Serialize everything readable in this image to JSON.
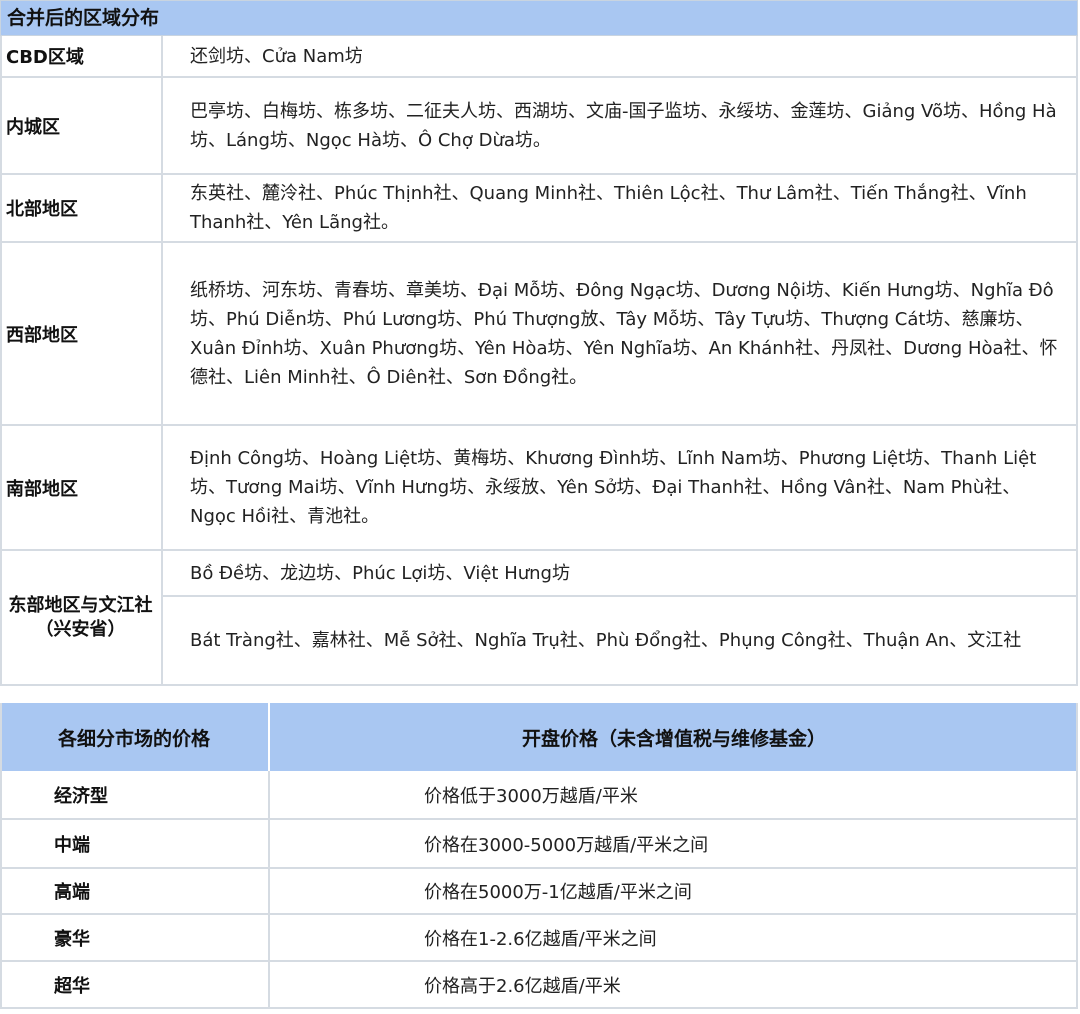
{
  "region_table": {
    "title": "合并后的区域分布",
    "rows": [
      {
        "label": "CBD区域",
        "text": "还剑坊、Cửa Nam坊"
      },
      {
        "label": "内城区",
        "text": "巴亭坊、白梅坊、栋多坊、二征夫人坊、西湖坊、文庙-国子监坊、永绥坊、金莲坊、Giảng Võ坊、Hồng Hà坊、Láng坊、Ngọc Hà坊、Ô Chợ Dừa坊。"
      },
      {
        "label": "北部地区",
        "text": "东英社、麓泠社、Phúc Thịnh社、Quang Minh社、Thiên Lộc社、Thư Lâm社、Tiến Thắng社、Vĩnh Thanh社、Yên Lãng社。"
      },
      {
        "label": "西部地区",
        "text": "纸桥坊、河东坊、青春坊、章美坊、Đại Mỗ坊、Đông Ngạc坊、Dương Nội坊、Kiến Hưng坊、Nghĩa Đô坊、Phú Diễn坊、Phú Lương坊、Phú Thượng放、Tây Mỗ坊、Tây Tựu坊、Thượng Cát坊、慈廉坊、Xuân Đỉnh坊、Xuân Phương坊、Yên Hòa坊、Yên Nghĩa坊、An Khánh社、丹凤社、Dương Hòa社、怀德社、Liên Minh社、Ô Diên社、Sơn Đồng社。"
      },
      {
        "label": "南部地区",
        "text": "Định Công坊、Hoàng Liệt坊、黄梅坊、Khương Đình坊、Lĩnh Nam坊、Phương Liệt坊、Thanh Liệt坊、Tương Mai坊、Vĩnh Hưng坊、永绥放、Yên Sở坊、Đại Thanh社、Hồng Vân社、Nam Phù社、Ngọc Hồi社、青池社。"
      },
      {
        "label": "东部地区与文江社（兴安省）",
        "text_a": "Bồ Đề坊、龙边坊、Phúc Lợi坊、Việt Hưng坊",
        "text_b": "Bát Tràng社、嘉林社、Mễ Sở社、Nghĩa Trụ社、Phù Đổng社、Phụng Công社、Thuận An、文江社"
      }
    ]
  },
  "price_table": {
    "header": {
      "col1": "各细分市场的价格",
      "col2": "开盘价格（未含增值税与维修基金）"
    },
    "rows": [
      {
        "segment": "经济型",
        "price": "价格低于3000万越盾/平米"
      },
      {
        "segment": "中端",
        "price": "价格在3000-5000万越盾/平米之间"
      },
      {
        "segment": "高端",
        "price": "价格在5000万-1亿越盾/平米之间"
      },
      {
        "segment": "豪华",
        "price": "价格在1-2.6亿越盾/平米之间"
      },
      {
        "segment": "超华",
        "price": "价格高于2.6亿越盾/平米"
      }
    ]
  }
}
